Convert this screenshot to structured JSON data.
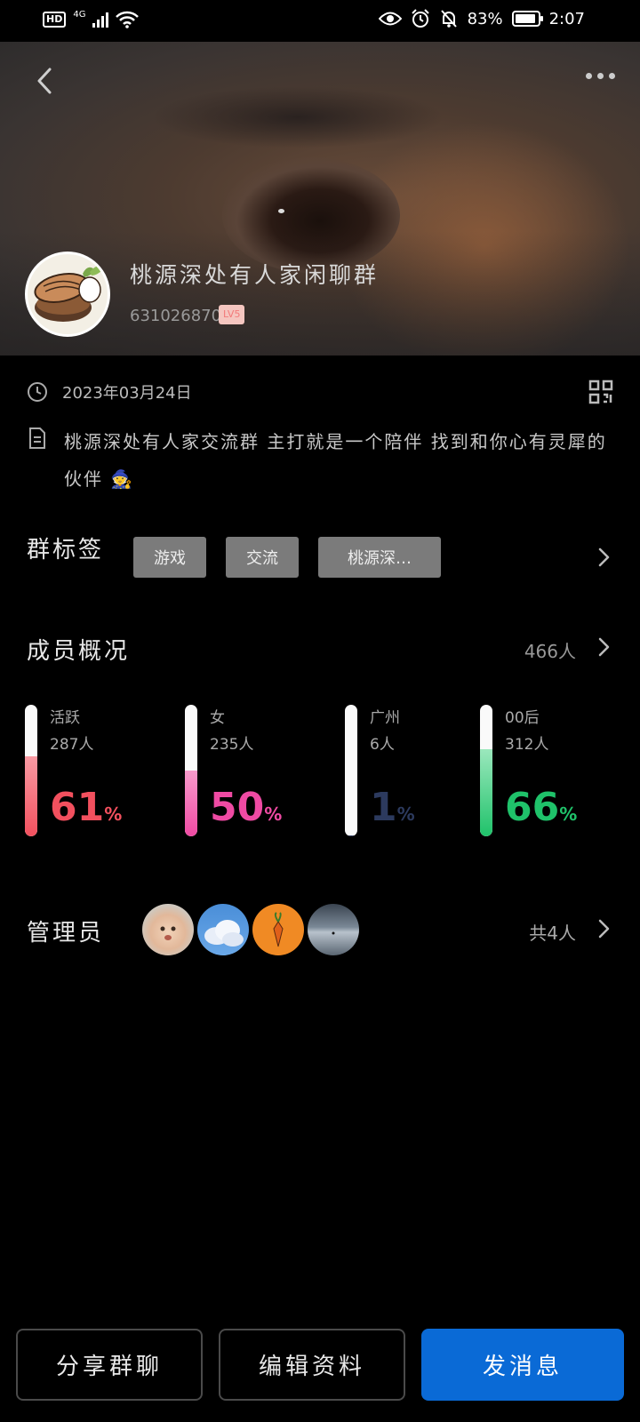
{
  "status_bar": {
    "hd": "HD",
    "network": "4G",
    "battery": "83%",
    "time": "2:07"
  },
  "group": {
    "name": "桃源深处有人家闲聊群",
    "id": "631026870",
    "level": "LV5",
    "created_date": "2023年03月24日",
    "description": "桃源深处有人家交流群 主打就是一个陪伴 找到和你心有灵犀的伙伴 🧙"
  },
  "tags_section": {
    "title": "群标签",
    "tags": [
      "游戏",
      "交流",
      "桃源深…"
    ]
  },
  "members_section": {
    "title": "成员概况",
    "total": "466人",
    "stats": [
      {
        "label": "活跃",
        "count": "287人",
        "percent": 61,
        "percent_text": "61",
        "unit": "%",
        "color": "#f2505e",
        "fill_top": "#f89aa3",
        "fill_bottom": "#f2505e"
      },
      {
        "label": "女",
        "count": "235人",
        "percent": 50,
        "percent_text": "50",
        "unit": "%",
        "color": "#ef4aa3",
        "fill_top": "#f79acb",
        "fill_bottom": "#ef4aa3"
      },
      {
        "label": "广州",
        "count": "6人",
        "percent": 1,
        "percent_text": "1",
        "unit": "%",
        "color": "#2c3a5e",
        "fill_top": "#2c3a5e",
        "fill_bottom": "#2c3a5e"
      },
      {
        "label": "00后",
        "count": "312人",
        "percent": 66,
        "percent_text": "66",
        "unit": "%",
        "color": "#1fc26a",
        "fill_top": "#9be8bd",
        "fill_bottom": "#1fc26a"
      }
    ]
  },
  "admins_section": {
    "title": "管理员",
    "count": "共4人",
    "avatars": [
      "baby-avatar",
      "cloud-avatar",
      "carrot-avatar",
      "sea-avatar"
    ]
  },
  "actions": {
    "share": "分享群聊",
    "edit": "编辑资料",
    "send": "发消息"
  }
}
